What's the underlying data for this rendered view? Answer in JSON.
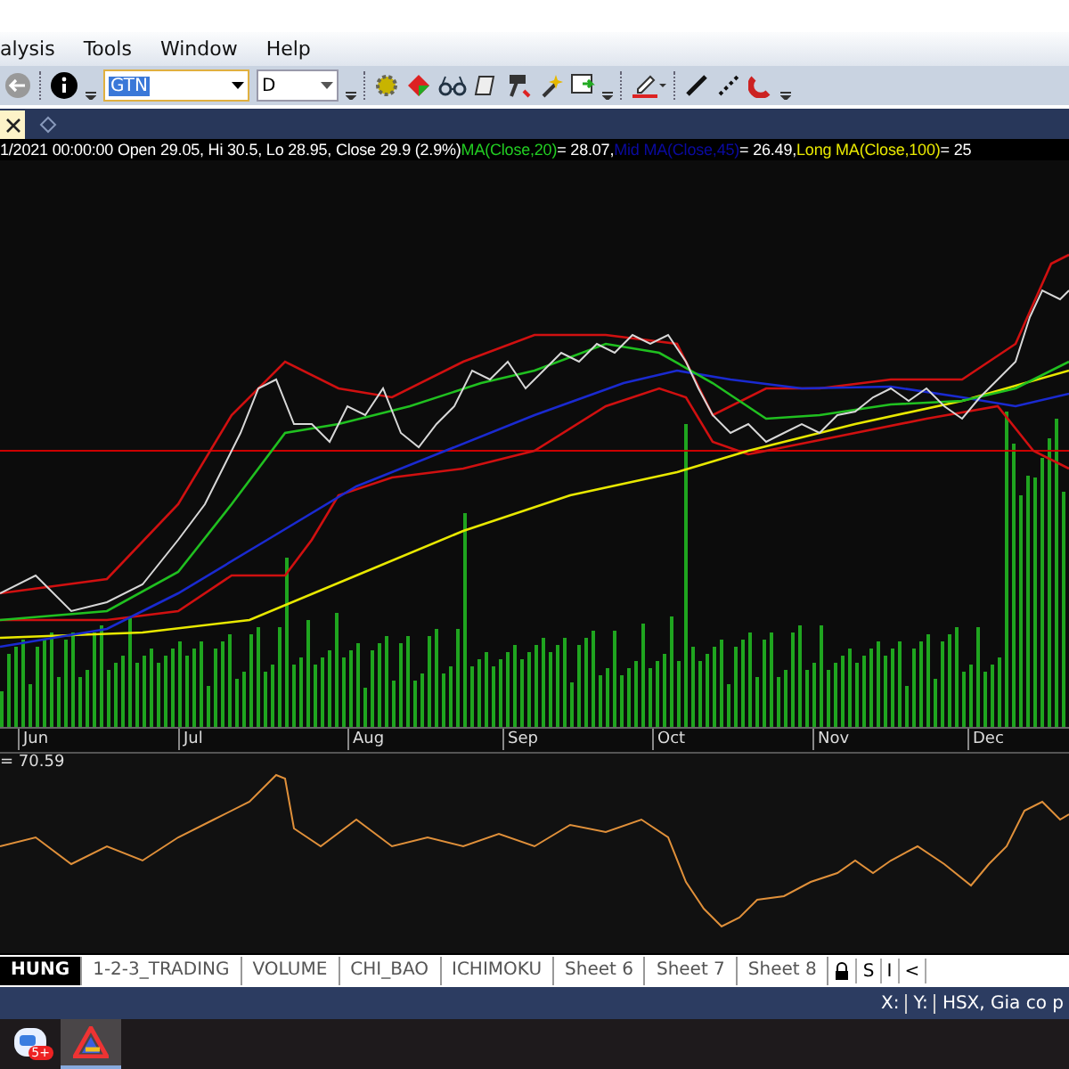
{
  "menu": [
    "alysis",
    "Tools",
    "Window",
    "Help"
  ],
  "toolbar": {
    "symbol": "GTN",
    "interval": "D"
  },
  "doc_tabs": [
    {
      "kind": "close",
      "selected": true
    },
    {
      "kind": "pin",
      "selected": false
    }
  ],
  "info_line": [
    {
      "text": "1/2021 00:00:00 Open 29.05, Hi 30.5, Lo 28.95, Close 29.9 (2.9%)",
      "color": "#ffffff"
    },
    {
      "text": "MA(Close,20)",
      "color": "#22cc22"
    },
    {
      "text": "= 28.07,",
      "color": "#ffffff"
    },
    {
      "text": "Mid MA(Close,45)",
      "color": "#0a0aa0"
    },
    {
      "text": "= 26.49,",
      "color": "#ffffff"
    },
    {
      "text": "Long MA(Close,100)",
      "color": "#e8e800"
    },
    {
      "text": "= 25",
      "color": "#ffffff"
    }
  ],
  "months": [
    "Jun",
    "Jul",
    "Aug",
    "Sep",
    "Oct",
    "Nov",
    "Dec"
  ],
  "indicator_reading": "= 70.59",
  "sheets": [
    {
      "label": "HUNG",
      "selected": true
    },
    {
      "label": "1-2-3_TRADING",
      "selected": false
    },
    {
      "label": "VOLUME",
      "selected": false
    },
    {
      "label": "CHI_BAO",
      "selected": false
    },
    {
      "label": "ICHIMOKU",
      "selected": false
    },
    {
      "label": "Sheet 6",
      "selected": false
    },
    {
      "label": "Sheet 7",
      "selected": false
    },
    {
      "label": "Sheet 8",
      "selected": false
    }
  ],
  "sheet_buttons": [
    {
      "kind": "lock"
    },
    {
      "kind": "text",
      "label": "S"
    },
    {
      "kind": "text",
      "label": "I"
    },
    {
      "kind": "text",
      "label": "<"
    }
  ],
  "status": [
    "X:",
    "Y:",
    "HSX, Gia co p"
  ],
  "taskbar": {
    "badge": "5+"
  }
}
